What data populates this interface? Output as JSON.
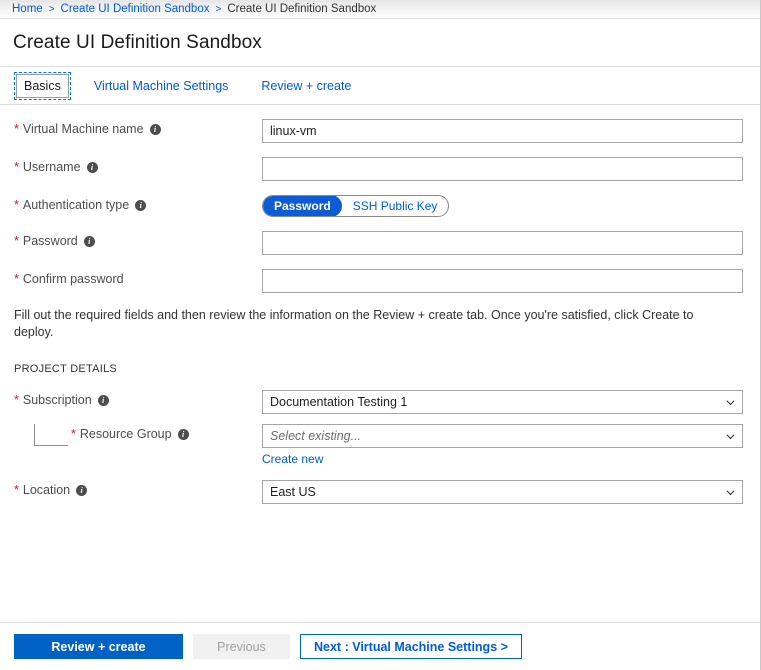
{
  "breadcrumb": {
    "items": [
      {
        "label": "Home",
        "type": "link"
      },
      {
        "label": "Create UI Definition Sandbox",
        "type": "link"
      },
      {
        "label": "Create UI Definition Sandbox",
        "type": "current"
      }
    ],
    "separator": ">"
  },
  "header": {
    "title": "Create UI Definition Sandbox"
  },
  "tabs": [
    {
      "label": "Basics",
      "active": true
    },
    {
      "label": "Virtual Machine Settings",
      "active": false
    },
    {
      "label": "Review + create",
      "active": false
    }
  ],
  "form": {
    "vm_name": {
      "label": "Virtual Machine name",
      "required": "*",
      "info": "i",
      "value": "linux-vm",
      "placeholder": ""
    },
    "username": {
      "label": "Username",
      "required": "*",
      "info": "i",
      "value": "",
      "placeholder": ""
    },
    "auth_type": {
      "label": "Authentication type",
      "required": "*",
      "info": "i",
      "options": [
        "Password",
        "SSH Public Key"
      ],
      "selected": "Password"
    },
    "password": {
      "label": "Password",
      "required": "*",
      "info": "i",
      "value": "",
      "placeholder": ""
    },
    "confirm_password": {
      "label": "Confirm password",
      "required": "*",
      "value": "",
      "placeholder": ""
    },
    "description": "Fill out the required fields and then review the information on the Review + create tab. Once you're satisfied, click Create to deploy.",
    "project_details_heading": "PROJECT DETAILS",
    "subscription": {
      "label": "Subscription",
      "required": "*",
      "info": "i",
      "value": "Documentation Testing 1"
    },
    "resource_group": {
      "label": "Resource Group",
      "required": "*",
      "info": "i",
      "value": "",
      "placeholder": "Select existing...",
      "create_new_link": "Create new"
    },
    "location": {
      "label": "Location",
      "required": "*",
      "info": "i",
      "value": "East US"
    }
  },
  "footer": {
    "review_create": "Review + create",
    "previous": "Previous",
    "next": "Next : Virtual Machine Settings >"
  },
  "colors": {
    "accent": "#0062c4",
    "link": "#015cda",
    "required_asterisk": "#e81123",
    "toggle_selected_bg": "#0b5cd5"
  }
}
